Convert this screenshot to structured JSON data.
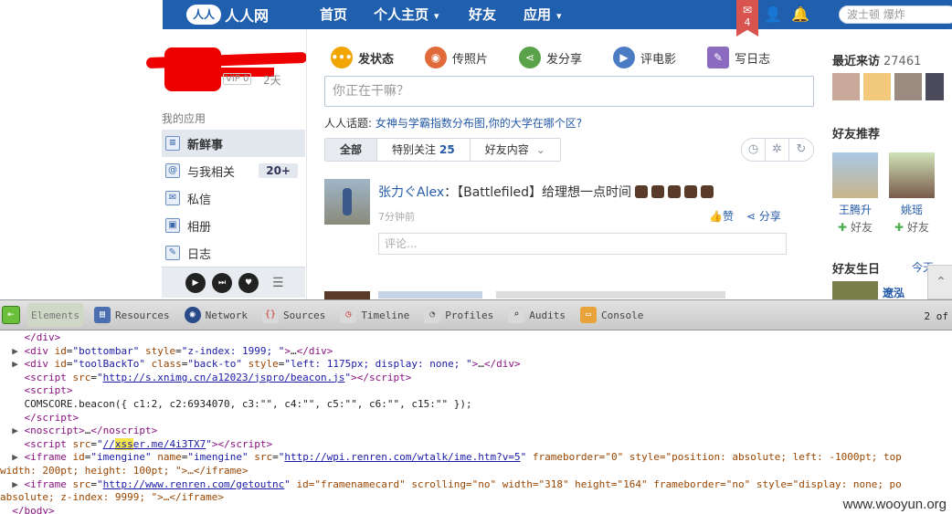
{
  "nav": {
    "logo": "人人网",
    "items": [
      {
        "label": "首页"
      },
      {
        "label": "个人主页"
      },
      {
        "label": "好友"
      },
      {
        "label": "应用"
      }
    ],
    "notification_count": "4",
    "search_placeholder": "波士顿 爆炸"
  },
  "sidebar": {
    "vip": "VIP 0",
    "days": "2天",
    "section_title": "我的应用",
    "items": [
      {
        "label": "新鲜事",
        "icon": "list-icon"
      },
      {
        "label": "与我相关",
        "icon": "mention-icon",
        "count": "20+"
      },
      {
        "label": "私信",
        "icon": "message-icon"
      },
      {
        "label": "相册",
        "icon": "album-icon"
      },
      {
        "label": "日志",
        "icon": "blog-icon"
      }
    ]
  },
  "composer": {
    "tabs": [
      {
        "label": "发状态",
        "color": "#f0a500"
      },
      {
        "label": "传照片",
        "color": "#e06a3a"
      },
      {
        "label": "发分享",
        "color": "#5aa24a"
      },
      {
        "label": "评电影",
        "color": "#4a7cc4"
      },
      {
        "label": "写日志",
        "color": "#8a6bc0"
      }
    ],
    "placeholder": "你正在干嘛？",
    "topic_prefix": "人人话题:",
    "topic_link": "女神与学霸指数分布图,你的大学在哪个区?"
  },
  "feed": {
    "filters": [
      {
        "label": "全部"
      },
      {
        "label": "特别关注",
        "count": "25"
      },
      {
        "label": "好友内容"
      }
    ],
    "item": {
      "author": "张力ぐAlex",
      "text": "：【Battlefiled】给理想一点时间",
      "time": "7分钟前",
      "like": "赞",
      "share": "分享",
      "comment_placeholder": "评论..."
    }
  },
  "right": {
    "visitors_title": "最近来访",
    "visitors_count": "27461",
    "recommend_title": "好友推荐",
    "recommend": [
      {
        "name": "王腾升",
        "action": "好友"
      },
      {
        "name": "姚瑶",
        "action": "好友"
      }
    ],
    "birthday_title": "好友生日",
    "birthday_link": "今天",
    "birthday_name": "遼泓"
  },
  "devtools": {
    "tabs": [
      "Elements",
      "Resources",
      "Network",
      "Sources",
      "Timeline",
      "Profiles",
      "Audits",
      "Console"
    ],
    "match_count": "2 of",
    "lines": {
      "l0": "</div>",
      "l1_attr_id": "bottombar",
      "l1_attr_style": "z-index: 1999; ",
      "l2_attr_id": "toolBackTo",
      "l2_attr_class": "back-to",
      "l2_attr_style": "left: 1175px; display: none; ",
      "l3_src": "http://s.xnimg.cn/a12023/jspro/beacon.js",
      "l5_text": "COMSCORE.beacon({ c1:2, c2:6934070, c3:\"\", c4:\"\", c5:\"\", c6:\"\", c15:\"\" });",
      "l8_src_pre": "//",
      "l8_src_hl": "xss",
      "l8_src_post": "er.me/4i3TX7",
      "l9_id": "imengine",
      "l9_name": "imengine",
      "l9_src": "http://wpi.renren.com/wtalk/ime.htm?v=5",
      "l9_rest": "frameborder=\"0\" style=\"position: absolute; left: -1000pt; top",
      "l10_text": "width: 200pt; height: 100pt; \">…</iframe>",
      "l11_src": "http://www.renren.com/getoutnc",
      "l11_rest": "id=\"framenamecard\" scrolling=\"no\" width=\"318\" height=\"164\" frameborder=\"no\" style=\"display: none; po",
      "l12_text": "absolute; z-index: 9999; \">…</iframe>",
      "l13_text": "</body>"
    }
  },
  "watermark": "www.wooyun.org"
}
